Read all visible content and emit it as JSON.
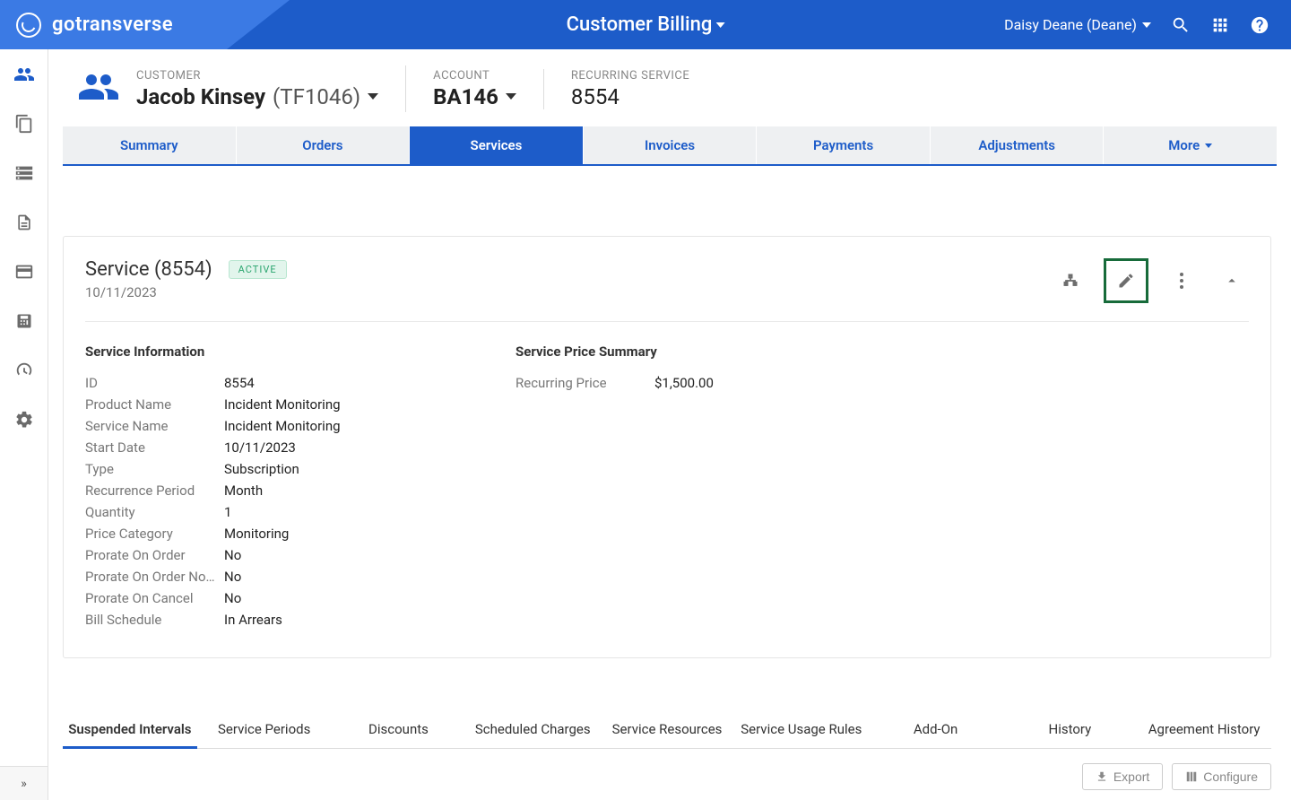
{
  "brand": "gotransverse",
  "header_title": "Customer Billing",
  "user_display": "Daisy Deane (Deane)",
  "breadcrumb": {
    "customer_label": "CUSTOMER",
    "customer_name": "Jacob Kinsey",
    "customer_code": "(TF1046)",
    "account_label": "ACCOUNT",
    "account_value": "BA146",
    "service_label": "RECURRING SERVICE",
    "service_value": "8554"
  },
  "tabs": {
    "summary": "Summary",
    "orders": "Orders",
    "services": "Services",
    "invoices": "Invoices",
    "payments": "Payments",
    "adjustments": "Adjustments",
    "more": "More"
  },
  "card": {
    "title": "Service (8554)",
    "status": "ACTIVE",
    "date": "10/11/2023",
    "info_heading": "Service Information",
    "price_heading": "Service Price Summary",
    "info": {
      "id_l": "ID",
      "id_v": "8554",
      "product_l": "Product Name",
      "product_v": "Incident Monitoring",
      "service_l": "Service Name",
      "service_v": "Incident Monitoring",
      "start_l": "Start Date",
      "start_v": "10/11/2023",
      "type_l": "Type",
      "type_v": "Subscription",
      "recur_l": "Recurrence Period",
      "recur_v": "Month",
      "qty_l": "Quantity",
      "qty_v": "1",
      "cat_l": "Price Category",
      "cat_v": "Monitoring",
      "poo_l": "Prorate On Order",
      "poo_v": "No",
      "poon_l": "Prorate On Order No…",
      "poon_v": "No",
      "poc_l": "Prorate On Cancel",
      "poc_v": "No",
      "bill_l": "Bill Schedule",
      "bill_v": "In Arrears"
    },
    "price": {
      "recurring_l": "Recurring Price",
      "recurring_v": "$1,500.00"
    }
  },
  "subtabs": {
    "suspended": "Suspended Intervals",
    "periods": "Service Periods",
    "discounts": "Discounts",
    "scheduled": "Scheduled Charges",
    "resources": "Service Resources",
    "usage": "Service Usage Rules",
    "addon": "Add-On",
    "history": "History",
    "agreement": "Agreement History"
  },
  "buttons": {
    "export": "Export",
    "configure": "Configure"
  }
}
